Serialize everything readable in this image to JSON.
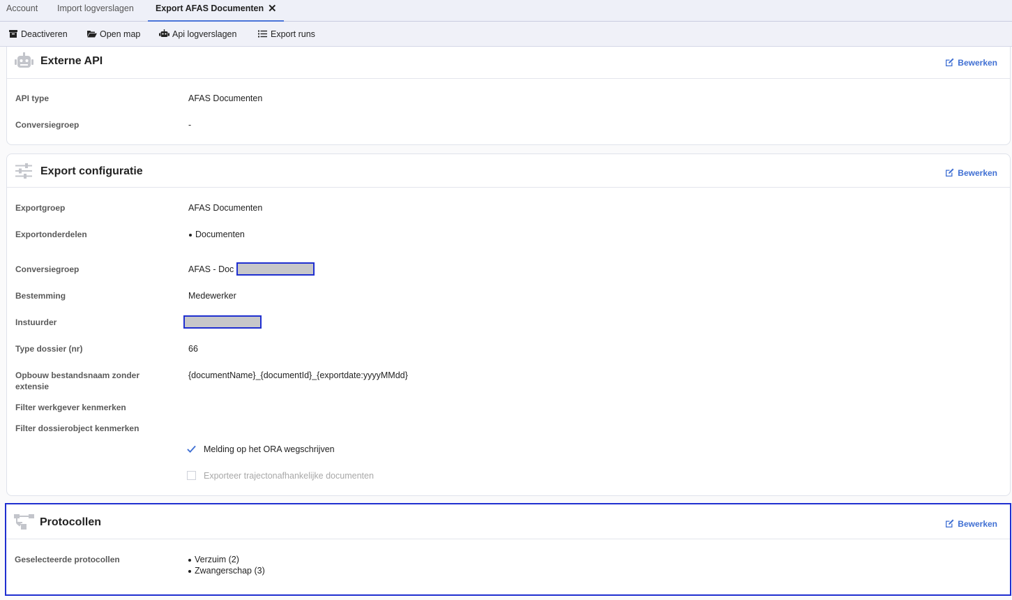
{
  "tabs": [
    {
      "label": "Account"
    },
    {
      "label": "Import logverslagen"
    },
    {
      "label": "Export AFAS Documenten",
      "close": "✕"
    }
  ],
  "toolbar": {
    "deactivate": "Deactiveren",
    "open_map": "Open map",
    "api_logs": "Api logverslagen",
    "export_runs": "Export runs"
  },
  "edit_label": "Bewerken",
  "external_api": {
    "title": "Externe API",
    "icon": "robot-icon",
    "api_type_label": "API type",
    "api_type_value": "AFAS Documenten",
    "conversion_label": "Conversiegroep",
    "conversion_value": "-"
  },
  "export_config": {
    "title": "Export configuratie",
    "icon": "sliders-icon",
    "exportgroup_label": "Exportgroep",
    "exportgroup_value": "AFAS Documenten",
    "parts_label": "Exportonderdelen",
    "parts": [
      "Documenten"
    ],
    "conversion_label": "Conversiegroep",
    "conversion_value": "AFAS - Doc -",
    "destination_label": "Bestemming",
    "destination_value": "Medewerker",
    "sender_label": "Instuurder",
    "dossier_type_label": "Type dossier (nr)",
    "dossier_type_value": "66",
    "filename_label": "Opbouw bestandsnaam zonder extensie",
    "filename_value": "{documentName}_{documentId}_{exportdate:yyyyMMdd}",
    "filter_employer_label": "Filter werkgever kenmerken",
    "filter_dossier_label": "Filter dossierobject kenmerken",
    "checkbox_ora": "Melding op het ORA wegschrijven",
    "checkbox_ora_checked": true,
    "checkbox_traject": "Exporteer trajectonafhankelijke documenten",
    "checkbox_traject_checked": false
  },
  "protocols": {
    "title": "Protocollen",
    "icon": "sitemap-icon",
    "selected_label": "Geselecteerde protocollen",
    "items": [
      "Verzuim (2)",
      "Zwangerschap (3)"
    ]
  },
  "colors": {
    "accent": "#3f6fd3",
    "selection": "#1f2fd0",
    "redaction": "#c7c7c9"
  }
}
